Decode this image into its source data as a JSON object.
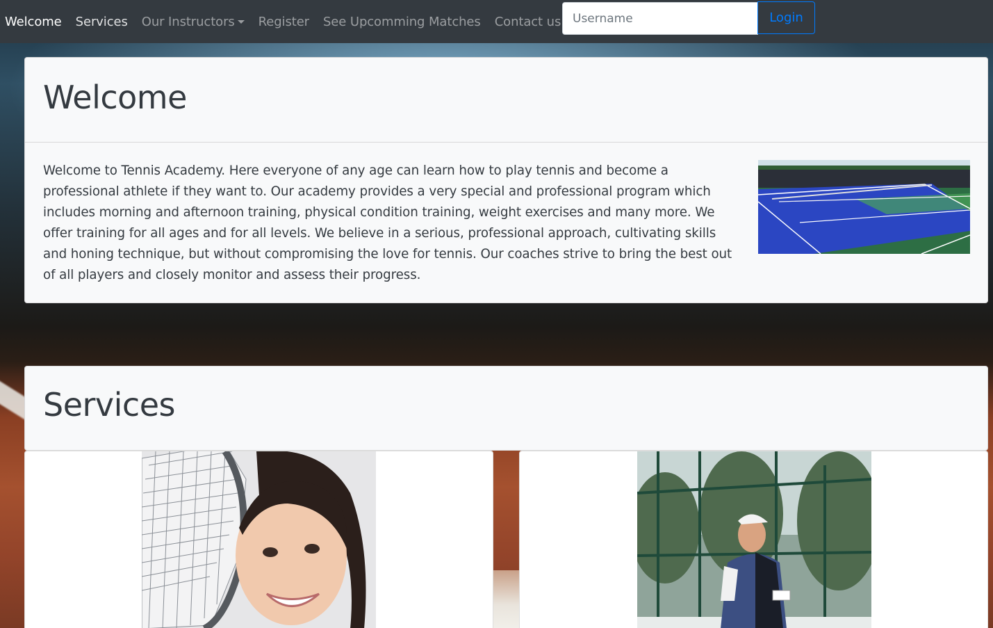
{
  "nav": {
    "links": [
      "Welcome",
      "Services",
      "Our Instructors",
      "Register",
      "See Upcomming Matches",
      "Contact us"
    ],
    "search_placeholder": "Username",
    "login_label": "Login"
  },
  "welcome": {
    "title": "Welcome",
    "body": "Welcome to Tennis Academy. Here everyone of any age can learn how to play tennis and become a professional athlete if they want to. Our academy provides a very special and professional program which includes morning and afternoon training, physical condition training, weight exercises and many more. We offer training for all ages and for all levels. We believe in a serious, professional approach, cultivating skills and honing technique, but without compromising the love for tennis. Our coaches strive to bring the best out of all players and closely monitor and assess their progress."
  },
  "services": {
    "title": "Services"
  },
  "colors": {
    "navbar": "#343a40",
    "primary": "#007bff",
    "card_bg": "#f8f9fa"
  }
}
